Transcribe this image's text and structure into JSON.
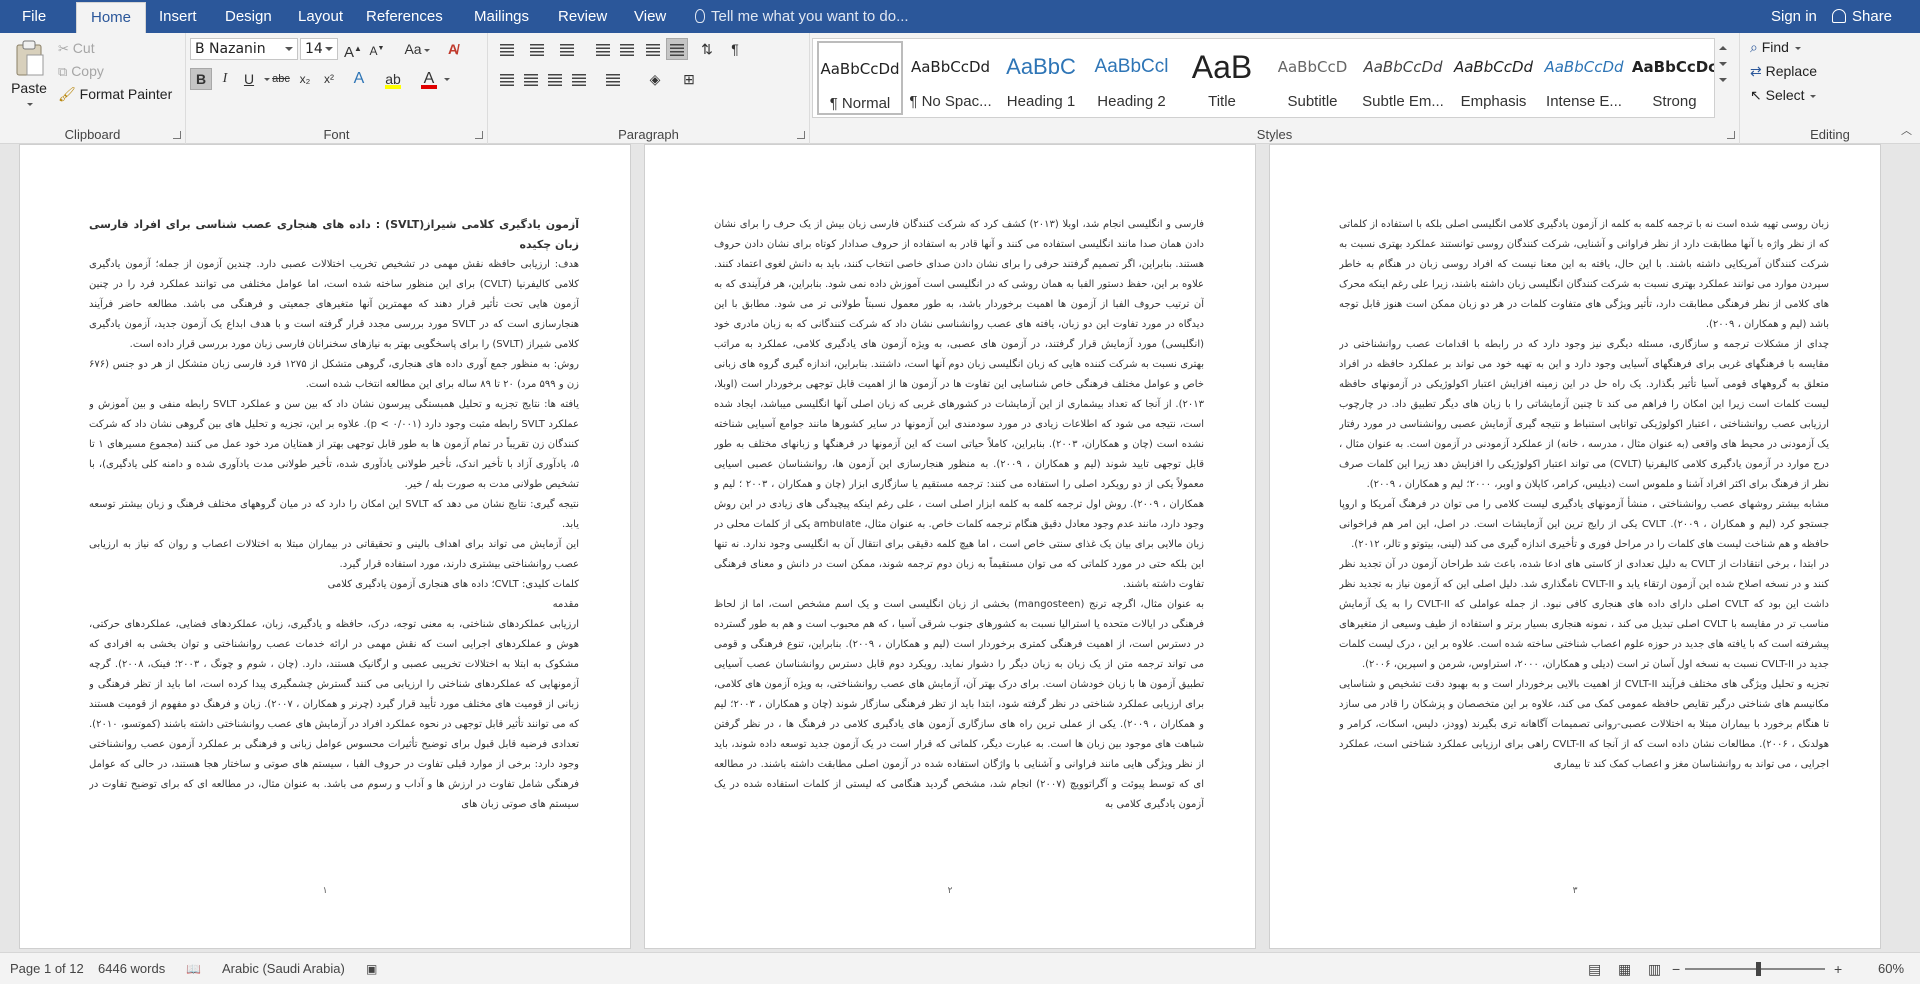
{
  "tabs": {
    "file": "File",
    "home": "Home",
    "insert": "Insert",
    "design": "Design",
    "layout": "Layout",
    "references": "References",
    "mailings": "Mailings",
    "review": "Review",
    "view": "View",
    "tellme": "Tell me what you want to do...",
    "signin": "Sign in",
    "share": "Share"
  },
  "clipboard": {
    "label": "Clipboard",
    "paste": "Paste",
    "cut": "Cut",
    "copy": "Copy",
    "format_painter": "Format Painter"
  },
  "font": {
    "label": "Font",
    "family": "B Nazanin",
    "size": "14",
    "bold": "B",
    "italic": "I",
    "underline": "U",
    "strike": "abc",
    "subscript": "x₂",
    "superscript": "x²",
    "grow": "A",
    "shrink": "A",
    "case": "Aa",
    "text_effects": "A",
    "font_color": "A"
  },
  "paragraph": {
    "label": "Paragraph"
  },
  "styles": {
    "label": "Styles",
    "items": [
      {
        "preview": "AaBbCcDd",
        "name": "¶ Normal"
      },
      {
        "preview": "AaBbCcDd",
        "name": "¶ No Spac..."
      },
      {
        "preview": "AaBbC",
        "name": "Heading 1"
      },
      {
        "preview": "AaBbCcl",
        "name": "Heading 2"
      },
      {
        "preview": "AaB",
        "name": "Title"
      },
      {
        "preview": "AaBbCcD",
        "name": "Subtitle"
      },
      {
        "preview": "AaBbCcDd",
        "name": "Subtle Em..."
      },
      {
        "preview": "AaBbCcDd",
        "name": "Emphasis"
      },
      {
        "preview": "AaBbCcDd",
        "name": "Intense E..."
      },
      {
        "preview": "AaBbCcDc",
        "name": "Strong"
      }
    ]
  },
  "editing": {
    "label": "Editing",
    "find": "Find",
    "replace": "Replace",
    "select": "Select"
  },
  "pages": [
    {
      "number": "۱",
      "title": "آزمون یادگیری کلامی شیراز(SVLT) : داده های هنجاری عصب شناسی برای افراد فارسی زبان چکیده",
      "paragraphs": [
        "هدف: ارزیابی حافظه نقش مهمی در تشخیص تخریب اختلالات عصبی دارد. چندین آزمون از جمله؛ آزمون یادگیری کلامی کالیفرنیا (CVLT) برای این منظور ساخته شده است، اما عوامل مختلفی می توانند عملکرد فرد را در چنین آزمون هایی تحت تأثیر قرار دهند که مهمترین آنها متغیرهای جمعیتی و فرهنگی می باشد. مطالعه حاضر فرآیند هنجارسازی است که در SVLT مورد بررسی مجدد قرار گرفته است و با هدف ابداع یک آزمون جدید، آزمون یادگیری کلامی شیراز (SVLT) را برای پاسخگویی بهتر به نیازهای سخنرانان فارسی زبان مورد بررسی قرار داده است.",
        "روش: به منظور جمع آوری داده های هنجاری، گروهی متشکل از ۱۲۷۵ فرد فارسی زبان متشکل از هر دو جنس (۶۷۶ زن و ۵۹۹ مرد) ۲۰ تا ۸۹ ساله برای این مطالعه انتخاب شده است.",
        "یافته ها: نتایج تجزیه و تحلیل همبستگی پیرسون نشان داد که بین سن و عملکرد SVLT رابطه منفی و بین آموزش و عملکرد SVLT رابطه مثبت وجود دارد (p < ۰/۰۰۱). علاوه بر این، تجزیه و تحلیل های بین گروهی نشان داد که شرکت کنندگان زن تقریباً در تمام آزمون ها به طور قابل توجهی بهتر از همتایان مرد خود عمل می کنند (مجموع مسیرهای ۱ تا ۵، یادآوری آزاد با تأخیر اندک، تأخیر طولانی یادآوری شده، تأخیر طولانی مدت یادآوری شده و دامنه کلی یادگیری)، با تشخیص طولانی مدت به صورت بله / خیر.",
        "نتیجه گیری: نتایج نشان می دهد که SVLT این امکان را دارد که در میان گروههای مختلف فرهنگ و زبان بیشتر توسعه یابد.",
        "این آزمایش می تواند برای اهداف بالینی و تحقیقاتی در بیماران مبتلا به اختلالات اعصاب و روان که نیاز به ارزیابی عصب روانشناختی بیشتری دارند، مورد استفاده قرار گیرد.",
        "کلمات کلیدی: CVLT؛ داده های هنجاری آزمون یادگیری کلامی",
        "مقدمه",
        "ارزیابی عملکردهای شناختی، به معنی توجه، درک، حافظه و یادگیری، زبان، عملکردهای فضایی، عملکردهای حرکتی، هوش و عملکردهای اجرایی است که نقش مهمی در ارائه خدمات عصب روانشناختی و توان بخشی به افرادی که مشکوک به ابتلا به اختلالات تخریبی عصبی و ارگانیک هستند، دارد. (چان ، شوم و چونگ ، ۲۰۰۳؛ فینک، ۲۰۰۸). گرچه آزمونهایی که عملکردهای شناختی را ارزیابی می کنند گسترش چشمگیری پیدا کرده است، اما باید از تظر فرهنگی و زبانی از قومیت های مختلف مورد تأیید قرار گیرد (چرنر و همکاران ، ۲۰۰۷). زبان و فرهنگ دو مفهوم از قومیت هستند که می توانند تأثیر قابل توجهی در نحوه عملکرد افراد در آزمایش های عصب روانشناختی داشته باشند (کموتسو، ۲۰۱۰). تعدادی فرضیه قابل قبول برای توضیح تأثیرات محسوس عوامل زبانی و فرهنگی بر عملکرد آزمون عصب روانشناختی وجود دارد: برخی از موارد قبلی تفاوت در حروف الفبا ، سیستم های صوتی و ساختار هجا هستند، در حالی که عوامل فرهنگی شامل تفاوت در ارزش ها و آداب و رسوم می باشد. به عنوان مثال، در مطالعه ای که برای توضیح تفاوت در سیستم های صوتی زبان های"
      ]
    },
    {
      "number": "۲",
      "title": "",
      "paragraphs": [
        "فارسی و انگلیسی انجام شد، اوبلا (۲۰۱۳) کشف کرد که شرکت کنندگان فارسی زبان بیش از یک حرف را برای نشان دادن همان صدا مانند انگلیسی استفاده می کنند و آنها قادر به استفاده از حروف صدادار کوتاه برای نشان دادن حروف هستند. بنابراین، اگر تصمیم گرفتند حرفی را برای نشان دادن صدای خاصی انتخاب کنند، باید به دانش لغوی اعتماد کنند. علاوه بر این، حفظ دستور الفبا به همان روشی که در انگلیسی است آموزش داده نمی شود. بنابراین، هر فرآیندی که به آن ترتیب حروف الفبا از آزمون ها اهمیت برخوردار باشد، به طور معمول نسبتاً طولانی تر می شود. مطابق با این دیدگاه در مورد تفاوت این دو زبان، یافته های عصب روانشناسی نشان داد که شرکت کنندگانی که به زبان مادری خود (انگلیسی) مورد آزمایش قرار گرفتند، در آزمون های عصبی، به ویژه آزمون های یادگیری کلامی، عملکرد به مراتب بهتری نسبت به شرکت کننده هایی که زبان انگلیسی زبان دوم آنها است، داشتند. بنابراین، اندازه گیری گروه های زبانی خاص و عوامل مختلف فرهنگی خاص شناسایی این تفاوت ها در آزمون ها از اهمیت قابل توجهی برخوردار است (اوبلا، ۲۰۱۳). از آنجا که تعداد بیشماری از این آزمایشات در کشورهای غربی که زبان اصلی آنها انگلیسی میباشد، ایجاد شده است، نتیجه می شود که اطلاعات زیادی در مورد سودمندی این آزمونها در سایر کشورها مانند جوامع آسیایی شناخته نشده است (چان و همکاران، ۲۰۰۳). بنابراین، کاملاً حیاتی است که این آزمونها در فرهنگها و زبانهای مختلف به طور قابل توجهی تایید شوند (لیم و همکاران ، ۲۰۰۹). به منظور هنجارسازی این آزمون ها، روانشناسان عصبی اسیایی معمولاً یکی از دو رویکرد اصلی را استفاده می کنند: ترجمه مستقیم یا سازگاری ابزار (چان و همکاران ، ۲۰۰۳ ؛ لیم و همکاران ، ۲۰۰۹). روش اول ترجمه کلمه به کلمه ابزار اصلی است ، علی رغم اینکه پیچیدگی های زیادی در این روش وجود دارد، مانند عدم وجود معادل دقیق هنگام ترجمه کلمات خاص. به عنوان مثال، ambulate یکی از کلمات محلی در زبان مالایی برای بیان یک غذای سنتی خاص است ، اما هیچ کلمه دقیقی برای انتقال آن به انگلیسی وجود ندارد. نه تنها این بلکه حتی در مورد کلماتی که می توان مستقیماً به زبان دوم ترجمه شوند، ممکن است در دانش و معنای فرهنگی تفاوت داشته باشند.",
        "به عنوان مثال، اگرچه ترنج (mangosteen) بخشی از زبان انگلیسی است و یک اسم مشخص است، اما از لحاظ فرهنگی در ایالات متحده یا استرالیا نسبت به کشورهای جنوب شرقی آسیا ، که هم محبوب است و هم به طور گسترده در دسترس است، از اهمیت فرهنگی کمتری برخوردار است (لیم و همکاران ، ۲۰۰۹). بنابراین، تنوع فرهنگی و قومی می تواند ترجمه متن از یک زبان به زبان دیگر را دشوار نماید. رویکرد دوم قابل دسترس روانشناسان عصب آسیایی تطبیق آزمون ها با زبان خودشان است. برای درک بهتر آن، آزمایش های عصب روانشناختی، به ویژه آزمون های کلامی، برای ارزیابی عملکرد شناختی در نظر گرفته شود، ابتدا باید از تظر فرهنگی سازگار شوند (چان و همکاران ، ۲۰۰۳؛ لیم و همکاران ، ۲۰۰۹). یکی از عملی ترین راه های سازگاری آزمون های یادگیری کلامی در فرهنگ ها ، در نظر گرفتن شباهت های موجود بین زبان ها است. به عبارت دیگر، کلماتی که قرار است در یک آزمون جدید توسعه داده شوند، باید از نظر ویژگی هایی مانند فراوانی و آشنایی با واژگان استفاده شده در آزمون اصلی مطابقت داشته باشند. در مطالعه ای که توسط پیوئت و آگراتوویچ (۲۰۰۷) انجام شد، مشخص گردید هنگامی که لیستی از کلمات استفاده شده در یک آزمون یادگیری کلامی به"
      ]
    },
    {
      "number": "۳",
      "title": "",
      "paragraphs": [
        "زبان روسی تهیه شده است نه با ترجمه کلمه به کلمه از آزمون یادگیری کلامی انگلیسی اصلی بلکه با استفاده از کلماتی که از نظر واژه با آنها مطابقت دارد از نظر فراوانی و آشنایی، شرکت کنندگان روسی توانستند عملکرد بهتری نسبت به شرکت کنندگان آمریکایی داشته باشند. با این حال، یافته به این معنا نیست که افراد روسی زبان در هنگام به خاطر سپردن موارد می توانند عملکرد بهتری نسبت به شرکت کنندگان انگلیسی زبان داشته باشند، زیرا علی رغم اینکه محرک های کلامی از نظر فرهنگی مطابقت دارد، تأثیر ویژگی های متفاوت کلمات در هر دو زبان ممکن است هنوز قابل توجه باشد (لیم و همکاران ، ۲۰۰۹).",
        "چدای از مشکلات ترجمه و سازگاری، مسئله دیگری نیز وجود دارد که در رابطه با اقدامات عصب روانشناختی در مقایسه با فرهنگهای غربی برای فرهنگهای آسیایی وجود دارد و این به تهیه خود می تواند بر عملکرد حافظه در افراد متعلق به گروههای قومی آسیا تأثیر بگذارد. یک راه حل در این زمینه افزایش اعتبار اکولوژیکی در آزمونهای حافظه لیست کلمات است زیرا این امکان را فراهم می کند تا چنین آزمایشاتی را با زبان های دیگر تطبیق داد. در چارچوب ارزیابی عصب روانشناختی ، اعتبار اکولوژیکی توانایی استنباط و نتیجه گیری آزمایش عصبی روانشناسی در مورد رفتار یک آزمودنی در محیط های واقعی (به عنوان مثال ، مدرسه ، خانه) از عملکرد آزمودنی در آزمون است. به عنوان مثال ، درج موارد در آزمون یادگیری کلامی کالیفرنیا (CVLT) می تواند اعتبار اکولوژیکی را افزایش دهد زیرا این کلمات صرف نظر از فرهنگ برای اکثر افراد آشنا و ملموس است (دیلیس، کرامر، کاپلان و اوبر، ۲۰۰۰؛ لیم و همکاران ، ۲۰۰۹).",
        "مشابه بیشتر روشهای عصب روانشناختی ، منشأ آزمونهای یادگیری لیست کلامی را می توان در فرهنگ آمریکا و اروپا جستجو کرد (لیم و همکاران ، ۲۰۰۹). CVLT یکی از رایج ترین این آزمایشات است. در اصل، این امر هم فراخوانی حافظه و هم شناخت لیست های کلمات را در مراحل فوری و تأخیری اندازه گیری می کند (لینی، بیتوتو و تالر، ۲۰۱۲).",
        "در ابتدا ، برخی انتقادات از CVLT به دلیل تعدادی از کاستی های ادعا شده، باعث شد طراحان آزمون در آن تجدید نظر کنند و در نسخه اصلاح شده این آزمون ارتقاء یابد و CVLT-II نامگذاری شد. دلیل اصلی این که آزمون نیاز به تجدید نظر داشت این بود که CVLT اصلی دارای داده های هنجاری کافی نبود. از جمله عواملی که CVLT-II را به یک آزمایش مناسب تر در مقایسه با CVLT اصلی تبدیل می کند ، نمونه هنجاری بسیار برتر و استفاده از طیف وسیعی از متغیرهای پیشرفته است که با یافته های جدید در حوزه علوم اعصاب شناختی ساخته شده است. علاوه بر این ، درک لیست کلمات جدید در CVLT-II نسبت به نسخه اول آسان تر است (دیلی و همکاران، ۲۰۰۰، استراوس، شرمن و اسپرین، ۲۰۰۶).",
        "تجزیه و تحلیل ویژگی های مختلف فرآیند CVLT-II از اهمیت بالایی برخوردار است و به بهبود دقت تشخیص و شناسایی مکانیسم های شناختی درگیر تقایص حافظه عمومی کمک می کند، علاوه بر این متخصصان و پزشکان را قادر می سازد تا هنگام برخورد با بیماران مبتلا به اختلالات عصبی-روانی تصمیمات آگاهانه تری بگیرند (وودز، دلیس، اسکات، کرامر و هولدنک ، ۲۰۰۶). مطالعات نشان داده است که از آنجا که CVLT-II راهی برای ارزیابی عملکرد شناختی است، عملکرد اجرایی ، می تواند به روانشناسان مغز و اعصاب کمک کند تا بیماری"
      ]
    }
  ],
  "status": {
    "page": "Page 1 of 12",
    "words": "6446 words",
    "language": "Arabic (Saudi Arabia)",
    "zoom": "60%"
  }
}
